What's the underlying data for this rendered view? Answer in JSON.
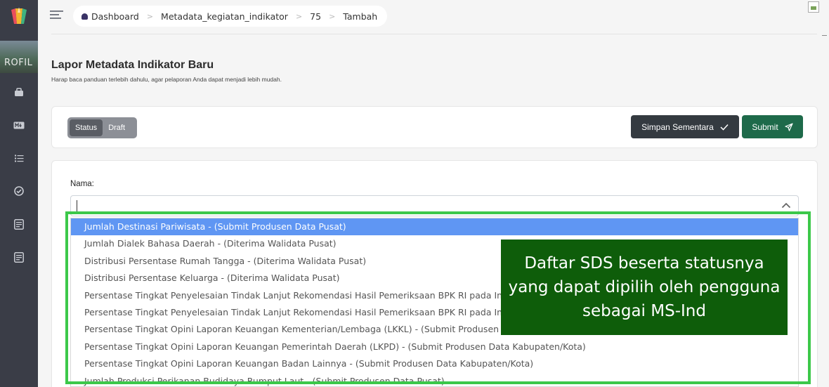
{
  "sidebar": {
    "profile_label": "ROFIL",
    "icons": [
      "bag-icon",
      "markdown-icon",
      "list-icon",
      "check-circle-icon",
      "document-icon",
      "document-icon"
    ]
  },
  "breadcrumb": [
    "Dashboard",
    "Metadata_kegiatan_indikator",
    "75",
    "Tambah"
  ],
  "page": {
    "title": "Lapor Metadata Indikator Baru",
    "subtitle": "Harap baca panduan terlebih dahulu, agar pelaporan Anda dapat menjadi lebih mudah."
  },
  "status_toggle": {
    "options": [
      "Status",
      "Draft"
    ],
    "selected": "Status"
  },
  "buttons": {
    "save_draft": "Simpan Sementara",
    "submit": "Submit"
  },
  "form": {
    "name_label": "Nama:",
    "name_value": "",
    "options": [
      "Jumlah Destinasi Pariwisata - (Submit Produsen Data Pusat)",
      "Jumlah Dialek Bahasa Daerah - (Diterima Walidata Pusat)",
      "Distribusi Persentase Rumah Tangga - (Diterima Walidata Pusat)",
      "Distribusi Persentase Keluarga - (Diterima Walidata Pusat)",
      "Persentase Tingkat Penyelesaian Tindak Lanjut Rekomendasi Hasil Pemeriksaan BPK RI pada Instansi Pemerintah Pusat (Submit Produsen Data BUM",
      "Persentase Tingkat Penyelesaian Tindak Lanjut Rekomendasi Hasil Pemeriksaan BPK RI pada Instansi Pemerintah Daerah",
      "Persentase Tingkat Opini Laporan Keuangan Kementerian/Lembaga (LKKL) - (Submit Produsen Data Kabupaten/Kota)",
      "Persentase Tingkat Opini Laporan Keuangan Pemerintah Daerah (LKPD) - (Submit Produsen Data Kabupaten/Kota)",
      "Persentase Tingkat Opini Laporan Keuangan Badan Lainnya - (Submit Produsen Data Kabupaten/Kota)",
      "Jumlah Produksi Perikanan Budidaya Rumput Laut - (Submit Produsen Data Pusat)"
    ],
    "highlighted_index": 0
  },
  "annotation": {
    "text": "Daftar SDS beserta statusnya yang dapat dipilih oleh pengguna sebagai MS-Ind"
  },
  "colors": {
    "sidebar": "#3a3d47",
    "submit": "#1e6a4a",
    "save": "#343a40",
    "highlight": "#5f96f3",
    "frame": "#3cc84a",
    "callout": "#0e5d0a"
  }
}
